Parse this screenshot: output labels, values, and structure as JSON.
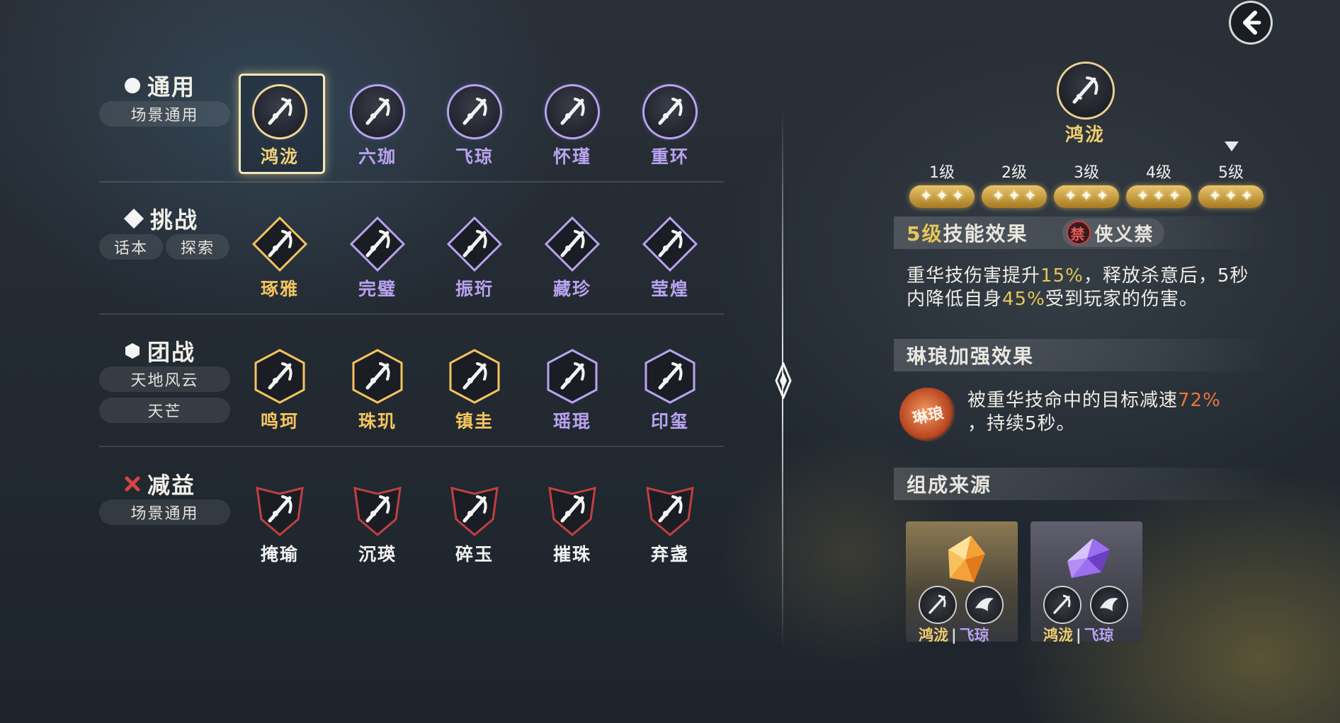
{
  "back_button": {
    "icon": "back-arrow-icon"
  },
  "categories": [
    {
      "title": "通用",
      "mark": "circle",
      "tags": [
        "场景通用"
      ],
      "skills": [
        {
          "label": "鸿泷",
          "color": "#f3d27a",
          "shape": "circle",
          "icon": "sword-slash-icon",
          "selected": true
        },
        {
          "label": "六珈",
          "color": "#b9a3f0",
          "shape": "circle",
          "icon": "lotus-icon"
        },
        {
          "label": "飞琼",
          "color": "#b9a3f0",
          "shape": "circle",
          "icon": "phoenix-icon"
        },
        {
          "label": "怀瑾",
          "color": "#b9a3f0",
          "shape": "circle",
          "icon": "shield-icon"
        },
        {
          "label": "重环",
          "color": "#b9a3f0",
          "shape": "circle",
          "icon": "blade-burst-icon"
        }
      ]
    },
    {
      "title": "挑战",
      "mark": "diamond",
      "tags": [
        "话本",
        "探索"
      ],
      "skills": [
        {
          "label": "琢雅",
          "color": "#f3c45e",
          "shape": "diamond",
          "icon": "crossed-blades-icon"
        },
        {
          "label": "完璧",
          "color": "#b9a3f0",
          "shape": "diamond",
          "icon": "warrior-icon"
        },
        {
          "label": "振珩",
          "color": "#b9a3f0",
          "shape": "diamond",
          "icon": "demon-mask-icon"
        },
        {
          "label": "藏珍",
          "color": "#b9a3f0",
          "shape": "diamond",
          "icon": "phoenix-wings-icon"
        },
        {
          "label": "莹煌",
          "color": "#b9a3f0",
          "shape": "diamond",
          "icon": "flame-orb-icon"
        }
      ]
    },
    {
      "title": "团战",
      "mark": "hexagon",
      "tags": [
        "天地风云",
        "天芒"
      ],
      "skills": [
        {
          "label": "鸣珂",
          "color": "#f3c45e",
          "shape": "hexagon",
          "icon": "wind-swirl-icon"
        },
        {
          "label": "珠玑",
          "color": "#f3c45e",
          "shape": "hexagon",
          "icon": "feathers-icon"
        },
        {
          "label": "镇圭",
          "color": "#f3c45e",
          "shape": "hexagon",
          "icon": "ward-icon"
        },
        {
          "label": "瑶琨",
          "color": "#b9a3f0",
          "shape": "hexagon",
          "icon": "sword-ring-icon"
        },
        {
          "label": "印玺",
          "color": "#b9a3f0",
          "shape": "hexagon",
          "icon": "dagger-strike-icon"
        }
      ]
    },
    {
      "title": "减益",
      "mark": "cross",
      "tags": [
        "场景通用"
      ],
      "skills": [
        {
          "label": "掩瑜",
          "color": "#f2f2f2",
          "shape": "shield",
          "icon": "vortex-icon"
        },
        {
          "label": "沉瑛",
          "color": "#f2f2f2",
          "shape": "shield",
          "icon": "drop-down-icon"
        },
        {
          "label": "碎玉",
          "color": "#f2f2f2",
          "shape": "shield",
          "icon": "broken-blade-icon"
        },
        {
          "label": "摧珠",
          "color": "#f2f2f2",
          "shape": "shield",
          "icon": "helmet-icon"
        },
        {
          "label": "弃盏",
          "color": "#f2f2f2",
          "shape": "shield",
          "icon": "sword-spikes-icon"
        }
      ]
    }
  ],
  "detail": {
    "name": "鸿泷",
    "icon": "sword-slash-icon",
    "levels": [
      "1级",
      "2级",
      "3级",
      "4级",
      "5级"
    ],
    "stars_per_level": 3,
    "effect_section": {
      "level_text": "5级",
      "title_text": "技能效果",
      "badge_char": "禁",
      "badge_text": "侠义禁",
      "desc_line1_a": "重华技伤害提升",
      "desc_line1_pct": "15%",
      "desc_line1_b": "，释放杀意后，5秒",
      "desc_line2_a": "内降低自身",
      "desc_line2_pct": "45%",
      "desc_line2_b": "受到玩家的伤害。"
    },
    "enhance_section": {
      "title": "琳琅加强效果",
      "emblem_text": "琳琅",
      "desc_a": "被重华技命中的目标减速",
      "desc_pct": "72%",
      "desc_b": "，持续5秒。"
    },
    "source_section": {
      "title": "组成来源",
      "cards": [
        {
          "gem": "orange",
          "left": "鸿泷",
          "sep": "|",
          "right": "飞琼"
        },
        {
          "gem": "purple",
          "left": "鸿泷",
          "sep": "|",
          "right": "飞琼"
        }
      ]
    }
  },
  "colors": {
    "gold": "#e6c65a",
    "purple": "#b9a3f0",
    "accent_red": "#e8773e"
  }
}
